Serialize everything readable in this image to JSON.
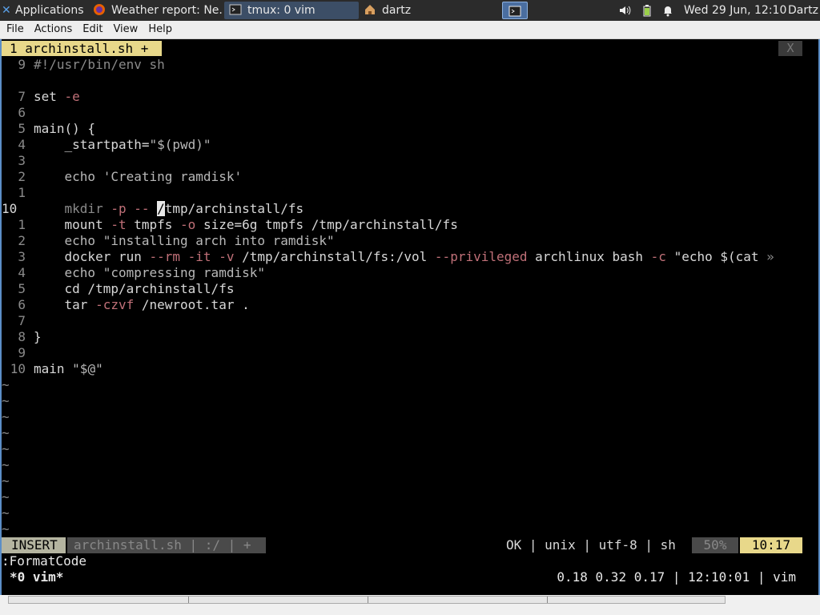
{
  "panel": {
    "app_menu": "Applications",
    "tasks": [
      {
        "label": "Weather report: Ne..."
      },
      {
        "label": "tmux: 0 vim"
      },
      {
        "label": "dartz"
      }
    ],
    "clock": "Wed 29 Jun, 12:10",
    "user": "Dartz"
  },
  "menubar": [
    "File",
    "Actions",
    "Edit",
    "View",
    "Help"
  ],
  "tab": {
    "label": "1 archinstall.sh +",
    "close": "X"
  },
  "code": [
    {
      "ln": "9",
      "segs": [
        {
          "c": "cm",
          "t": "#!/usr/bin/env sh"
        }
      ]
    },
    {
      "ln": "",
      "segs": []
    },
    {
      "ln": "7",
      "segs": [
        {
          "c": "kw",
          "t": "set "
        },
        {
          "c": "fl",
          "t": "-e"
        }
      ]
    },
    {
      "ln": "6",
      "segs": []
    },
    {
      "ln": "5",
      "segs": [
        {
          "c": "kw",
          "t": "main() {"
        }
      ]
    },
    {
      "ln": "4",
      "segs": [
        {
          "c": "kw",
          "t": "    _startpath="
        },
        {
          "c": "st",
          "t": "\"$(pwd)\""
        }
      ]
    },
    {
      "ln": "3",
      "segs": []
    },
    {
      "ln": "2",
      "segs": [
        {
          "c": "st",
          "t": "    echo 'Creating ramdisk'"
        }
      ]
    },
    {
      "ln": "1",
      "segs": []
    },
    {
      "ln": "10",
      "cur": true,
      "segs": [
        {
          "c": "cm",
          "t": "    mkdir "
        },
        {
          "c": "fl",
          "t": "-p -- "
        },
        {
          "c": "cursor",
          "t": "/"
        },
        {
          "c": "kw",
          "t": "tmp/archinstall/fs"
        }
      ]
    },
    {
      "ln": "1",
      "segs": [
        {
          "c": "kw",
          "t": "    mount "
        },
        {
          "c": "fl",
          "t": "-t "
        },
        {
          "c": "kw",
          "t": "tmpfs "
        },
        {
          "c": "fl",
          "t": "-o "
        },
        {
          "c": "kw",
          "t": "size=6g tmpfs /tmp/archinstall/fs"
        }
      ]
    },
    {
      "ln": "2",
      "segs": [
        {
          "c": "st",
          "t": "    echo \"installing arch into ramdisk\""
        }
      ]
    },
    {
      "ln": "3",
      "segs": [
        {
          "c": "kw",
          "t": "    docker run "
        },
        {
          "c": "fl",
          "t": "--rm -it -v "
        },
        {
          "c": "kw",
          "t": "/tmp/archinstall/fs:/vol "
        },
        {
          "c": "fl",
          "t": "--privileged "
        },
        {
          "c": "kw",
          "t": "archlinux bash "
        },
        {
          "c": "fl",
          "t": "-c "
        },
        {
          "c": "kw",
          "t": "\"echo $(cat "
        },
        {
          "c": "cm",
          "t": "»"
        }
      ]
    },
    {
      "ln": "4",
      "segs": [
        {
          "c": "st",
          "t": "    echo \"compressing ramdisk\""
        }
      ]
    },
    {
      "ln": "5",
      "segs": [
        {
          "c": "kw",
          "t": "    cd /tmp/archinstall/fs"
        }
      ]
    },
    {
      "ln": "6",
      "segs": [
        {
          "c": "kw",
          "t": "    tar "
        },
        {
          "c": "fl",
          "t": "-czvf "
        },
        {
          "c": "kw",
          "t": "/newroot.tar ."
        }
      ]
    },
    {
      "ln": "7",
      "segs": []
    },
    {
      "ln": "8",
      "segs": [
        {
          "c": "kw",
          "t": "}"
        }
      ]
    },
    {
      "ln": "9",
      "segs": []
    },
    {
      "ln": "10",
      "segs": [
        {
          "c": "kw",
          "t": "main "
        },
        {
          "c": "st",
          "t": "\"$@\""
        }
      ]
    }
  ],
  "tildes": [
    "~",
    "~",
    "~",
    "~",
    "~",
    "~",
    "~",
    "~",
    "~",
    "~"
  ],
  "statusline": {
    "mode": "INSERT",
    "file": "archinstall.sh | :/ | +",
    "info": "OK | unix | utf-8 | sh",
    "percent": "50%",
    "position": "10:17"
  },
  "cmdline": ":FormatCode",
  "tmux": {
    "window": "*0 vim*",
    "right": "0.18 0.32 0.17 | 12:10:01 | vim"
  },
  "colors": {
    "accent_tab": "#e8d88a",
    "flag": "#c07078",
    "panel": "#2b2b2b",
    "frame": "#5b8ec7"
  }
}
